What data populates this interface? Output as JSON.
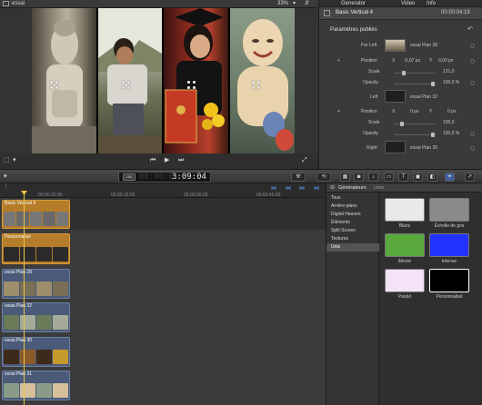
{
  "viewer": {
    "project_name": "essai",
    "zoom": "33%",
    "timecode": "3:09:04",
    "timecode_prefix": "00:00:0",
    "status_badge": "100"
  },
  "inspector": {
    "tabs": [
      "Generator",
      "Video",
      "Info"
    ],
    "title": "Basic Vertical 4",
    "duration": "00:00:04:19",
    "section": "Paramètres publiés",
    "far_left": {
      "label": "Far Left",
      "clip": "essai Plan 28"
    },
    "row1": {
      "position_label": "Position",
      "x_label": "X",
      "x_value": "-0,07 px",
      "y_label": "Y",
      "y_value": "0,03 px",
      "scale_label": "Scale",
      "scale_value": "121,0",
      "opacity_label": "Opacity",
      "opacity_value": "100,0 %"
    },
    "left": {
      "label": "Left",
      "clip": "essai Plan 32"
    },
    "row2": {
      "position_label": "Position",
      "x_label": "X",
      "x_value": "0 px",
      "y_label": "Y",
      "y_value": "0 px",
      "scale_label": "Scale",
      "scale_value": "100,0",
      "opacity_label": "Opacity",
      "opacity_value": "100,0 %"
    },
    "right": {
      "label": "Right",
      "clip": "essai Plan 30"
    }
  },
  "timeline": {
    "ruler": [
      "00:00:15:00",
      "00:00:30:00",
      "00:00:45:00"
    ],
    "tracks": [
      {
        "name": "Basic Vertical 4",
        "color": "orange"
      },
      {
        "name": "Personnalisé",
        "color": "orange"
      },
      {
        "name": "essai Plan 28",
        "color": "blue"
      },
      {
        "name": "essai Plan 32",
        "color": "blue"
      },
      {
        "name": "essai Plan 30",
        "color": "blue"
      },
      {
        "name": "essai Plan 31",
        "color": "blue"
      }
    ]
  },
  "browser": {
    "header_title": "Générateurs",
    "header_sub": "Unis",
    "categories": [
      "Tous",
      "Arrière-plans",
      "Digital Heaven",
      "Éléments",
      "Split Screen",
      "Textures",
      "Unis"
    ],
    "selected_category": "Unis",
    "tiles": [
      {
        "label": "Blanc",
        "color": "#e9e9e9"
      },
      {
        "label": "Échelle de gris",
        "color": "#8a8a8a"
      },
      {
        "label": "iMovie",
        "color": "#58a83c"
      },
      {
        "label": "Intense",
        "color": "#2233ff"
      },
      {
        "label": "Pastel",
        "color": "#f4e2f6"
      },
      {
        "label": "Personnalisé",
        "color": "#000000"
      }
    ]
  },
  "colors": {
    "accent_yellow": "#e6c44a",
    "clip_orange": "#b57d2a",
    "clip_blue": "#4a5a78"
  }
}
